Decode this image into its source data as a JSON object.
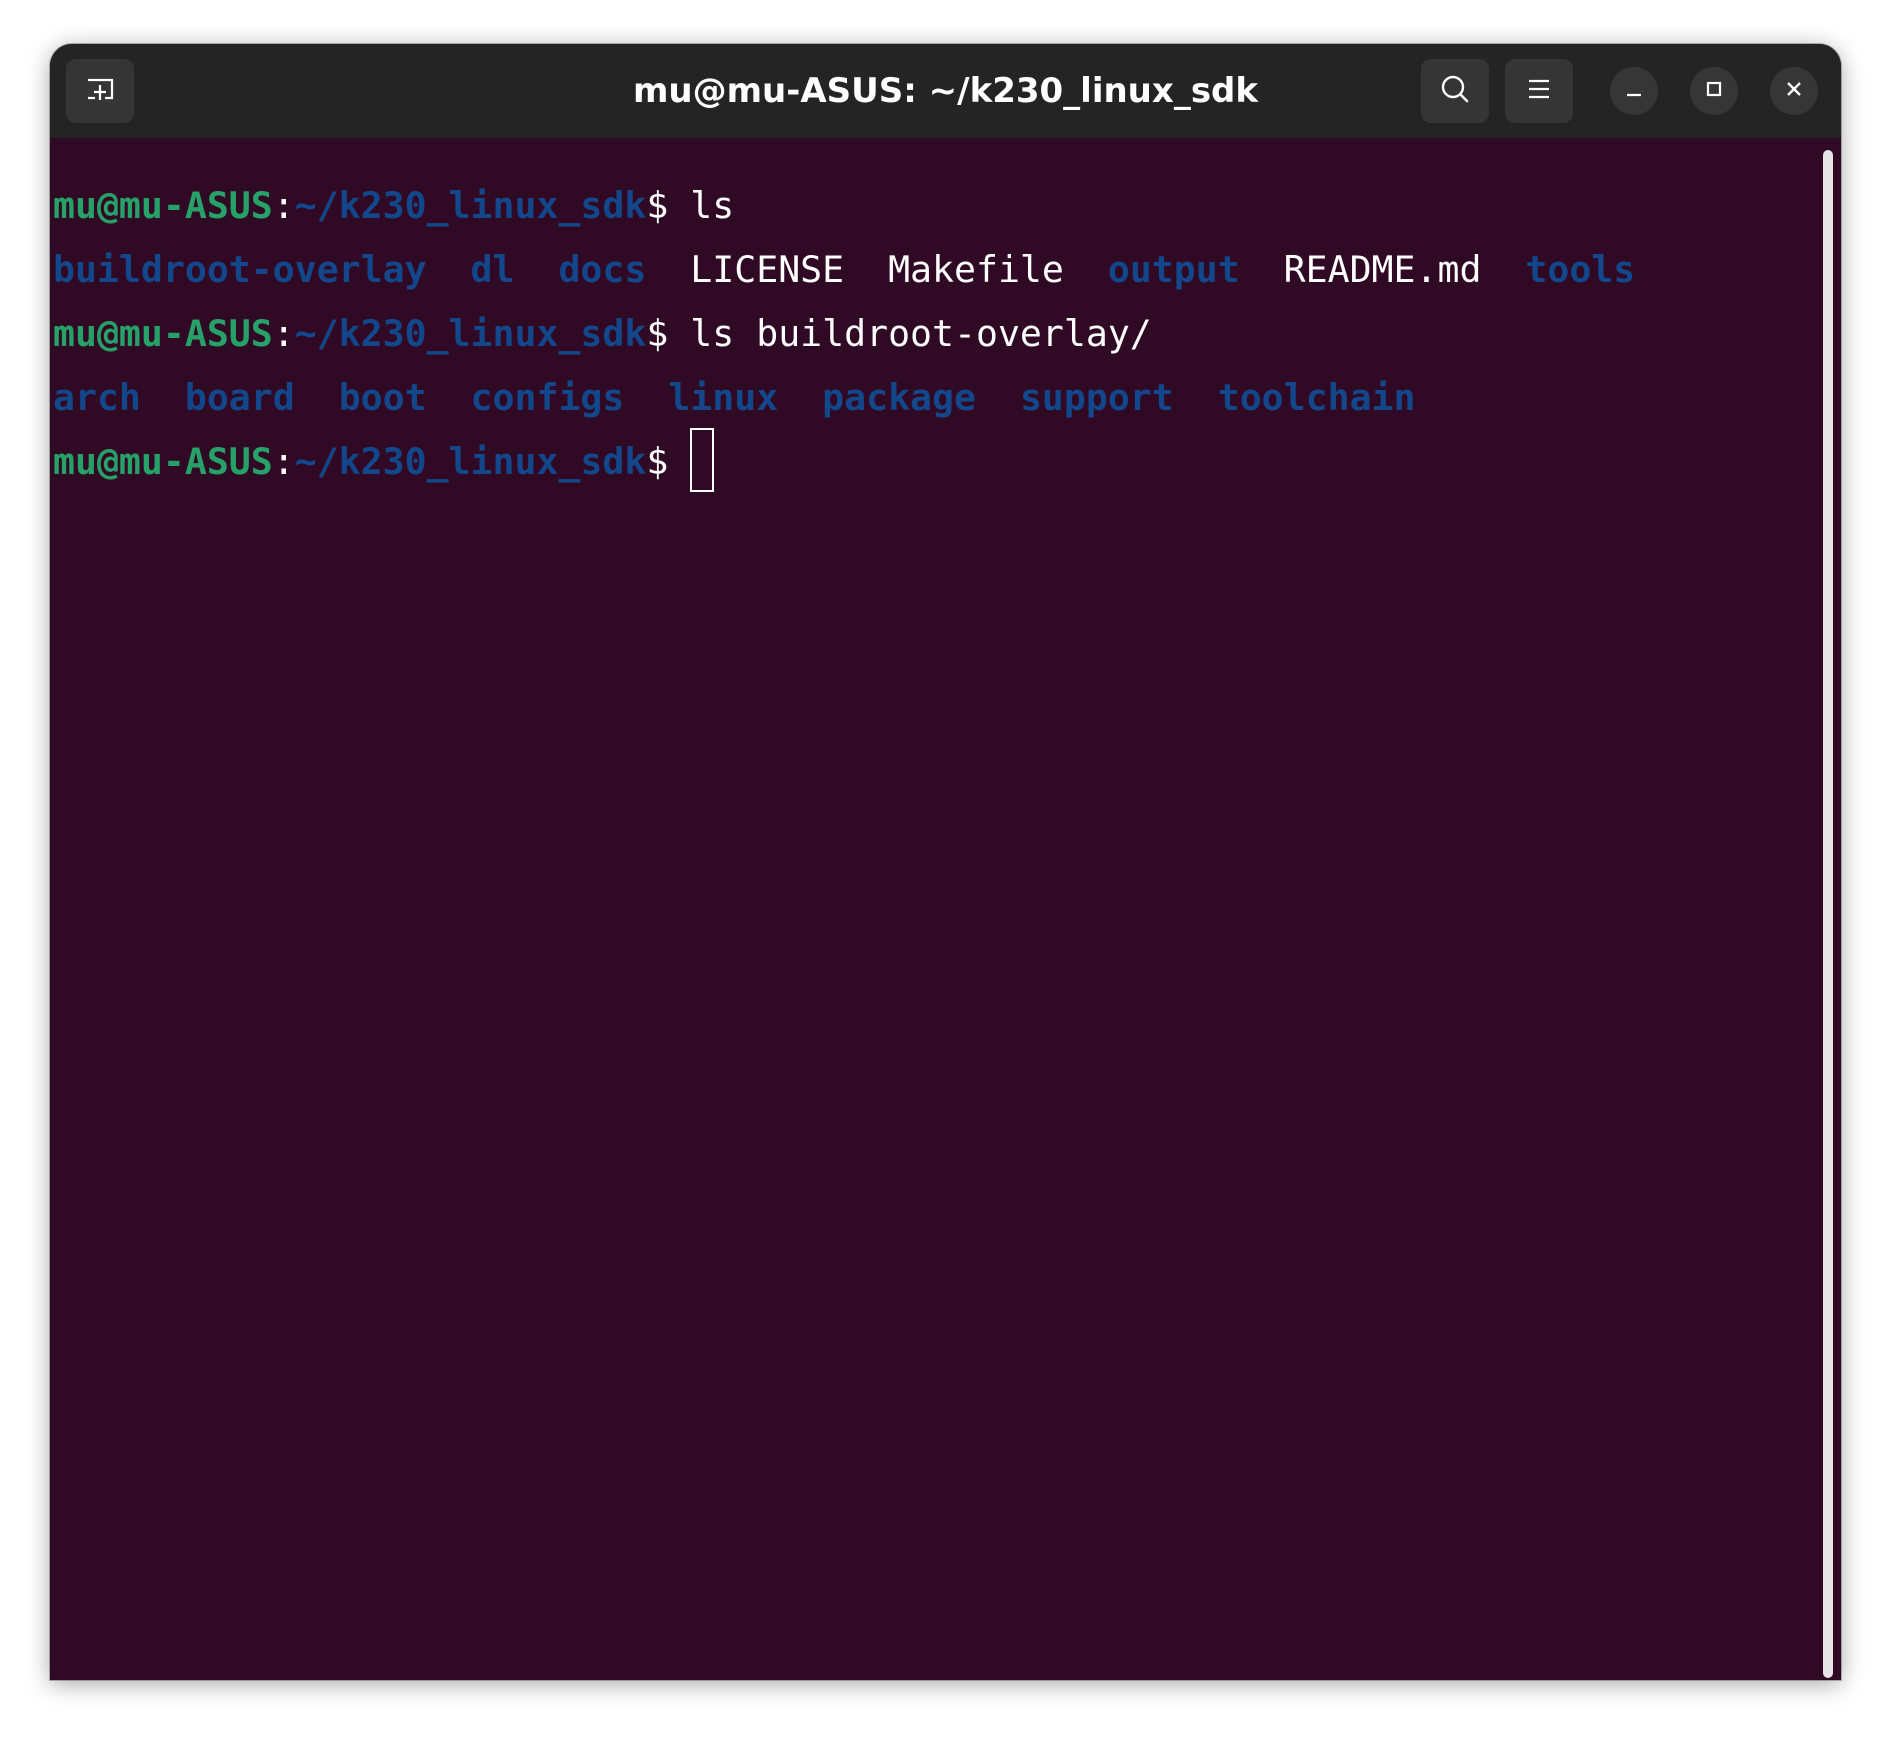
{
  "window": {
    "title": "mu@mu-ASUS: ~/k230_linux_sdk"
  },
  "titlebar_icons": {
    "new_tab": "new-tab-icon",
    "search": "search-icon",
    "menu": "hamburger-menu-icon",
    "minimize": "minimize-icon",
    "maximize": "maximize-icon",
    "close": "close-icon"
  },
  "colors": {
    "background": "#300a24",
    "titlebar": "#242424",
    "prompt_user": "#26a269",
    "directory": "#12488b",
    "text": "#ffffff"
  },
  "terminal": {
    "lines": [
      {
        "prompt_user": "mu@mu-ASUS",
        "prompt_sep": ":",
        "prompt_path": "~/k230_linux_sdk",
        "prompt_end": "$ ",
        "command": "ls"
      },
      {
        "entries": [
          {
            "name": "buildroot-overlay",
            "type": "dir"
          },
          {
            "name": "dl",
            "type": "dir"
          },
          {
            "name": "docs",
            "type": "dir"
          },
          {
            "name": "LICENSE",
            "type": "file"
          },
          {
            "name": "Makefile",
            "type": "file"
          },
          {
            "name": "output",
            "type": "dir"
          },
          {
            "name": "README.md",
            "type": "file"
          },
          {
            "name": "tools",
            "type": "dir"
          }
        ]
      },
      {
        "prompt_user": "mu@mu-ASUS",
        "prompt_sep": ":",
        "prompt_path": "~/k230_linux_sdk",
        "prompt_end": "$ ",
        "command": "ls buildroot-overlay/"
      },
      {
        "entries": [
          {
            "name": "arch",
            "type": "dir"
          },
          {
            "name": "board",
            "type": "dir"
          },
          {
            "name": "boot",
            "type": "dir"
          },
          {
            "name": "configs",
            "type": "dir"
          },
          {
            "name": "linux",
            "type": "dir"
          },
          {
            "name": "package",
            "type": "dir"
          },
          {
            "name": "support",
            "type": "dir"
          },
          {
            "name": "toolchain",
            "type": "dir"
          }
        ]
      },
      {
        "prompt_user": "mu@mu-ASUS",
        "prompt_sep": ":",
        "prompt_path": "~/k230_linux_sdk",
        "prompt_end": "$ ",
        "command": "",
        "cursor": true
      }
    ]
  }
}
